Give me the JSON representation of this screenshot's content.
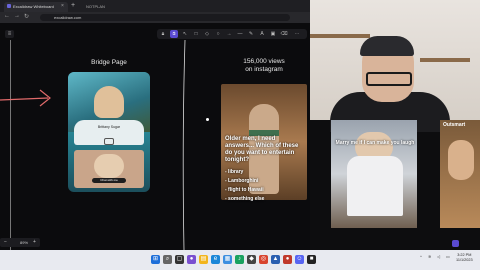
{
  "browser": {
    "tab_title": "Excalidraw Whiteboard",
    "tab2_title": "NOTPLAN",
    "url": "excalidraw.com",
    "new_tab": "+",
    "close": "×"
  },
  "canvas": {
    "bridge_label": "Bridge Page",
    "views_label": "156,000 views\non instagram",
    "phone": {
      "profile_name": "Brittany Sugar",
      "cta": "Chat with me"
    },
    "instagram_post": {
      "caption": "Older men, I need answers... Which of these do you want to entertain tonight?",
      "options": [
        "- library",
        "- Lamborghini",
        "- flight to Hawaii",
        "- something else"
      ]
    },
    "thumb1_caption": "Marry me if I can make you laugh",
    "thumb2_caption": "Outsmart"
  },
  "toolbar": {
    "icons": [
      "lock-icon",
      "hand-icon",
      "select-icon",
      "rect-icon",
      "diamond-icon",
      "ellipse-icon",
      "arrow-icon",
      "line-icon",
      "pencil-icon",
      "text-icon",
      "image-icon",
      "eraser-icon",
      "more-icon"
    ]
  },
  "footer": {
    "zoom": "89%"
  },
  "taskbar": {
    "time": "3:22 PM",
    "date": "11/1/2023"
  },
  "colors": {
    "accent": "#5a4ad1",
    "arrow": "#e06a6a"
  }
}
